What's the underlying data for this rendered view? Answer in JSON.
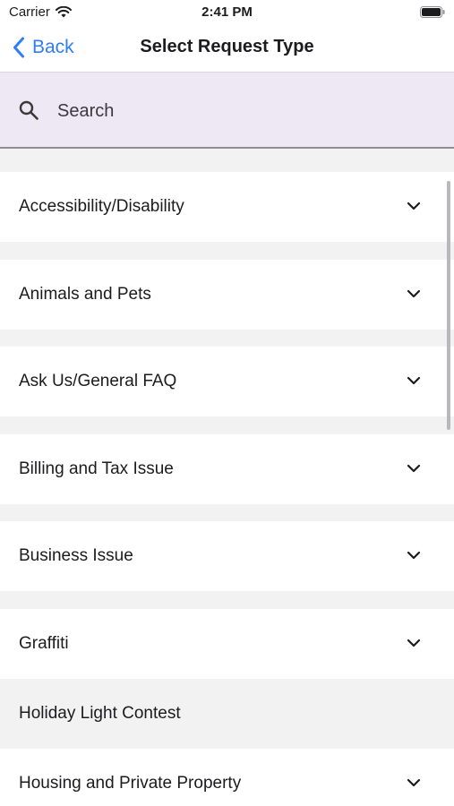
{
  "status_bar": {
    "carrier": "Carrier",
    "time": "2:41 PM"
  },
  "nav": {
    "back_label": "Back",
    "title": "Select Request Type"
  },
  "search": {
    "placeholder": "Search",
    "value": ""
  },
  "list": {
    "items": [
      {
        "label": "Accessibility/Disability",
        "expandable": true
      },
      {
        "label": "Animals and Pets",
        "expandable": true
      },
      {
        "label": "Ask Us/General FAQ",
        "expandable": true
      },
      {
        "label": "Billing and Tax Issue",
        "expandable": true
      },
      {
        "label": "Business Issue",
        "expandable": true
      },
      {
        "label": "Graffiti",
        "expandable": true
      },
      {
        "label": "Holiday Light Contest",
        "expandable": false
      },
      {
        "label": "Housing and Private Property",
        "expandable": true
      }
    ]
  },
  "colors": {
    "accent": "#2f7df6",
    "search_bg": "#ede8f3",
    "list_bg": "#f2f2f2"
  },
  "icons": {
    "back": "chevron-left-icon",
    "search": "search-icon",
    "expand": "chevron-down-icon"
  }
}
